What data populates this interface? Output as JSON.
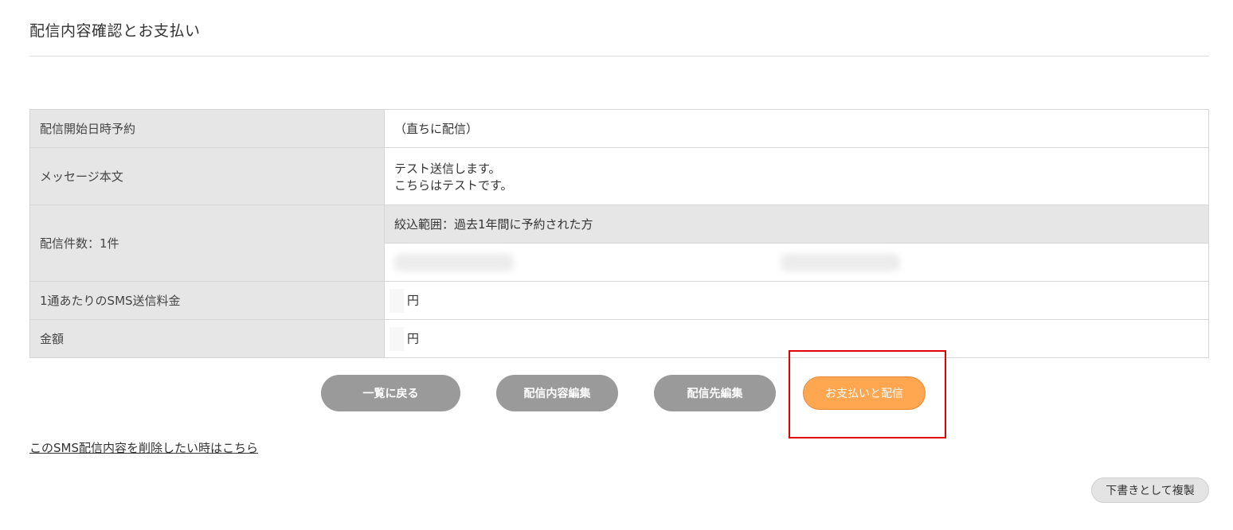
{
  "page": {
    "title": "配信内容確認とお支払い"
  },
  "table": {
    "schedule_label": "配信開始日時予約",
    "schedule_value": "（直ちに配信）",
    "message_label": "メッセージ本文",
    "message_line1": "テスト送信します。",
    "message_line2": "こちらはテストです。",
    "count_label": "配信件数：1件",
    "filter_text": "絞込範囲：過去1年間に予約された方",
    "unit_price_label": "1通あたりのSMS送信料金",
    "unit_price_suffix": "円",
    "amount_label": "金額",
    "amount_suffix": "円"
  },
  "buttons": {
    "back": "一覧に戻る",
    "edit_content": "配信内容編集",
    "edit_recipients": "配信先編集",
    "pay_and_send": "お支払いと配信",
    "copy_draft": "下書きとして複製"
  },
  "links": {
    "delete": "このSMS配信内容を削除したい時はこちら"
  },
  "colors": {
    "pay_button": "#ffa750",
    "gray_button": "#9a9a9a",
    "highlight": "#e00000",
    "label_bg": "#e6e6e6"
  }
}
